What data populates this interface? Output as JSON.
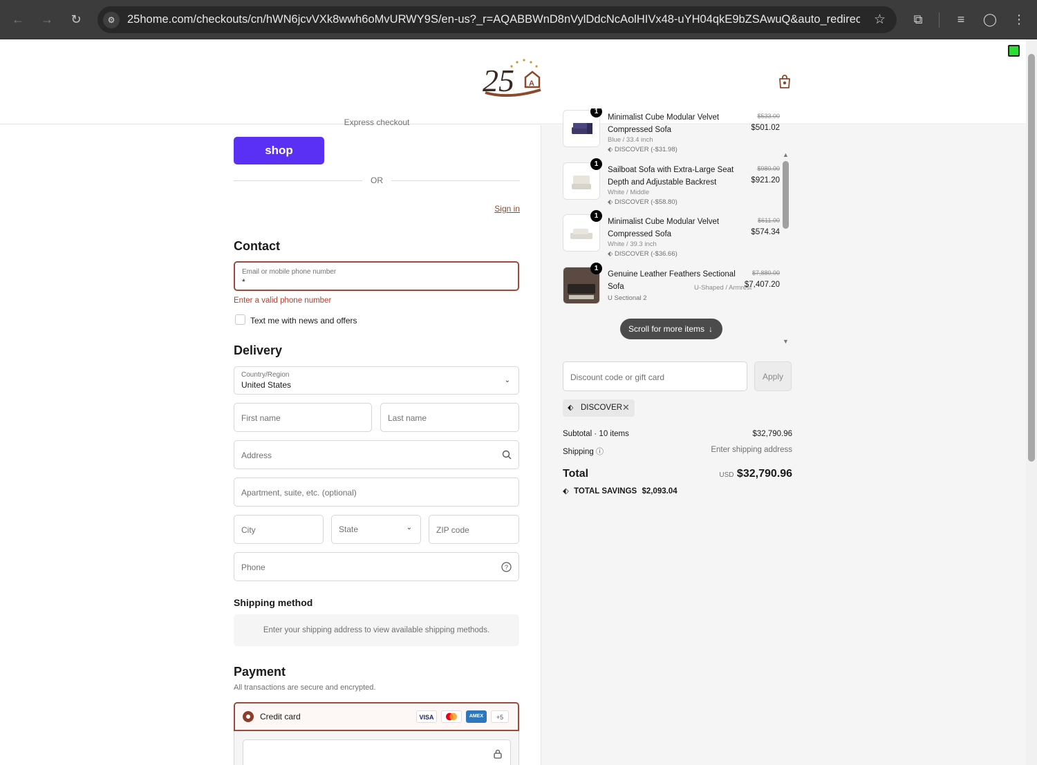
{
  "browser": {
    "url": "25home.com/checkouts/cn/hWN6jcvVXk8wwh6oMvURWY9S/en-us?_r=AQABBWnD8nVylDdcNcAolHIVx48-uYH04qkE9bZSAwuQ&auto_redirect..."
  },
  "contact": {
    "express_label": "Express checkout",
    "shop_button": "shop",
    "or_label": "OR",
    "heading": "Contact",
    "sign_in": "Sign in",
    "email_label": "Email or mobile phone number",
    "email_value": "*",
    "error": "Enter a valid phone number",
    "news_checkbox": "Text me with news and offers"
  },
  "delivery": {
    "heading": "Delivery",
    "country_label": "Country/Region",
    "country_value": "United States",
    "first_name": "First name",
    "last_name": "Last name",
    "address": "Address",
    "apartment": "Apartment, suite, etc. (optional)",
    "city": "City",
    "state": "State",
    "zip": "ZIP code",
    "phone": "Phone"
  },
  "shipping_method": {
    "heading": "Shipping method",
    "placeholder": "Enter your shipping address to view available shipping methods."
  },
  "payment": {
    "heading": "Payment",
    "subtitle": "All transactions are secure and encrypted.",
    "method": "Credit card",
    "card_logos": [
      "VISA",
      "AMEX",
      "+5"
    ]
  },
  "cart": {
    "items": [
      {
        "qty": "1",
        "name": "Minimalist Cube Modular Velvet Compressed Sofa",
        "variant": "Blue / 33.4 inch",
        "discount": "DISCOVER (-$31.98)",
        "old_price": "$533.00",
        "price": "$501.02"
      },
      {
        "qty": "1",
        "name": "Sailboat Sofa with Extra-Large Seat Depth and Adjustable Backrest",
        "variant": "White / Middle",
        "discount": "DISCOVER (-$58.80)",
        "old_price": "$980.00",
        "price": "$921.20"
      },
      {
        "qty": "1",
        "name": "Minimalist Cube Modular Velvet Compressed Sofa",
        "variant": "White / 39.3 inch",
        "discount": "DISCOVER (-$36.66)",
        "old_price": "$611.00",
        "price": "$574.34"
      },
      {
        "qty": "1",
        "name": "Genuine Leather Feathers Sectional Sofa",
        "variant": "U-Shaped / Armrest",
        "discount": "U Sectional 2",
        "old_price": "$7,880.00",
        "price": "$7,407.20"
      }
    ],
    "scroll_hint": "Scroll for more items",
    "discount_placeholder": "Discount code or gift card",
    "apply": "Apply",
    "applied_code": "DISCOVER",
    "subtotal_label": "Subtotal · 10 items",
    "subtotal_value": "$32,790.96",
    "shipping_label": "Shipping",
    "shipping_value": "Enter shipping address",
    "total_label": "Total",
    "currency": "USD",
    "total_value": "$32,790.96",
    "savings_label": "TOTAL SAVINGS",
    "savings_value": "$2,093.04"
  }
}
